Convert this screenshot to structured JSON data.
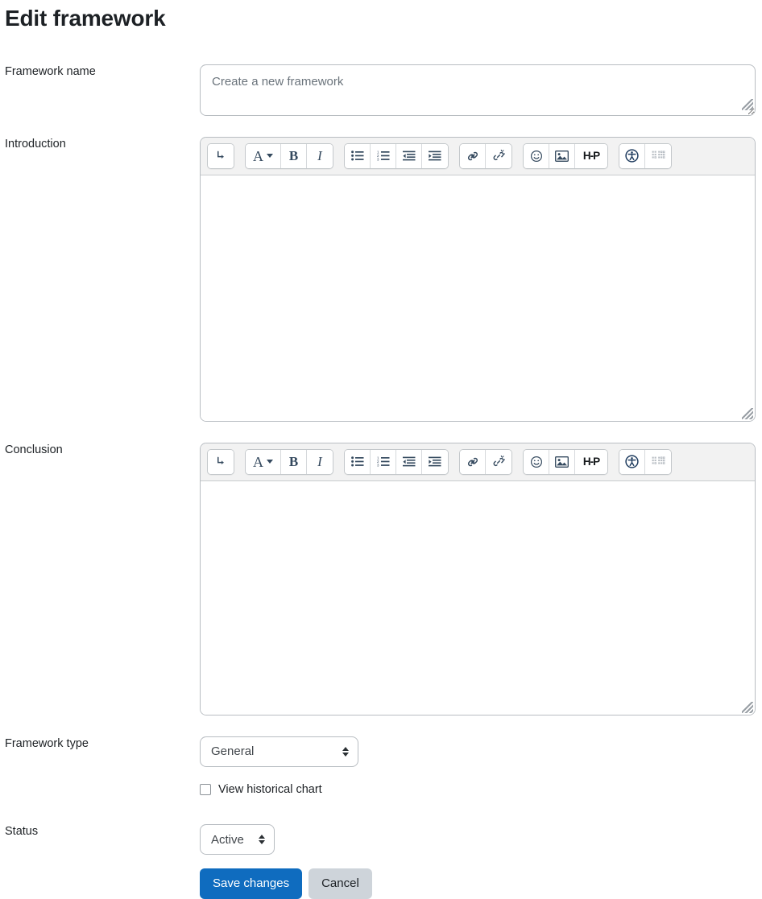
{
  "page": {
    "title": "Edit framework"
  },
  "fields": {
    "name": {
      "label": "Framework name",
      "placeholder": "Create a new framework",
      "value": ""
    },
    "introduction": {
      "label": "Introduction",
      "value": ""
    },
    "conclusion": {
      "label": "Conclusion",
      "value": ""
    },
    "framework_type": {
      "label": "Framework type",
      "selected": "General",
      "options": [
        "General"
      ]
    },
    "historical_chart": {
      "label": "View historical chart",
      "checked": false
    },
    "status": {
      "label": "Status",
      "selected": "Active",
      "options": [
        "Active"
      ]
    }
  },
  "editor_toolbar": {
    "groups": [
      {
        "name": "undo-group",
        "buttons": [
          {
            "name": "paragraph-style-icon",
            "label": "⤵",
            "title": "Paragraph style"
          }
        ]
      },
      {
        "name": "formatting-group",
        "buttons": [
          {
            "name": "font-color-icon",
            "label": "A",
            "title": "Font color"
          },
          {
            "name": "bold-icon",
            "label": "B",
            "title": "Bold"
          },
          {
            "name": "italic-icon",
            "label": "I",
            "title": "Italic"
          }
        ]
      },
      {
        "name": "list-group",
        "buttons": [
          {
            "name": "unordered-list-icon",
            "label": "",
            "title": "Bulleted list"
          },
          {
            "name": "ordered-list-icon",
            "label": "",
            "title": "Numbered list"
          },
          {
            "name": "outdent-icon",
            "label": "",
            "title": "Decrease indent"
          },
          {
            "name": "indent-icon",
            "label": "",
            "title": "Increase indent"
          }
        ]
      },
      {
        "name": "link-group",
        "buttons": [
          {
            "name": "link-icon",
            "label": "",
            "title": "Link"
          },
          {
            "name": "unlink-icon",
            "label": "",
            "title": "Unlink"
          }
        ]
      },
      {
        "name": "media-group",
        "buttons": [
          {
            "name": "emoticon-icon",
            "label": "",
            "title": "Emoticon"
          },
          {
            "name": "image-icon",
            "label": "",
            "title": "Image"
          },
          {
            "name": "h5p-icon",
            "label": "H-P",
            "title": "Insert H5P"
          }
        ]
      },
      {
        "name": "accessibility-group",
        "buttons": [
          {
            "name": "accessibility-checker-icon",
            "label": "",
            "title": "Accessibility checker"
          },
          {
            "name": "screenreader-helper-icon",
            "label": "",
            "title": "Screenreader helper"
          }
        ]
      }
    ]
  },
  "actions": {
    "save_label": "Save changes",
    "cancel_label": "Cancel"
  },
  "colors": {
    "primary": "#0f6cbf",
    "secondary": "#ced4da",
    "border": "#b8bdc2",
    "toolbar_bg": "#f2f2f2",
    "text": "#1d2125",
    "placeholder": "#6a737b"
  }
}
